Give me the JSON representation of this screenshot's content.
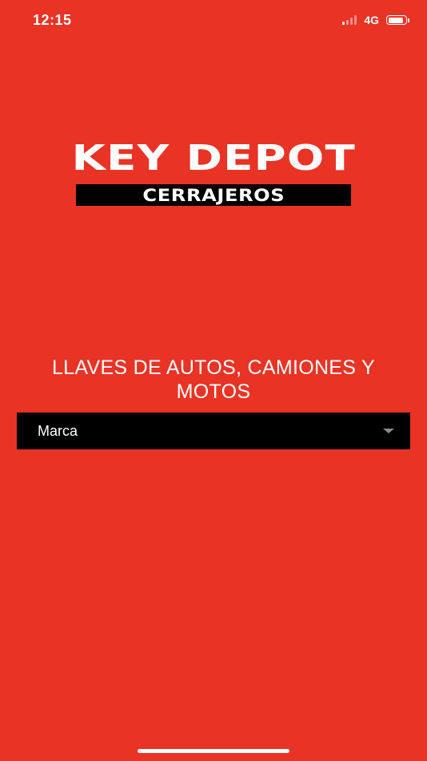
{
  "status_bar": {
    "time": "12:15",
    "network": "4G",
    "signal_bars_active": 1,
    "signal_bars_total": 4,
    "battery_level": 0.9
  },
  "logo": {
    "main": "KEY DEPOT",
    "sub": "CERRAJEROS"
  },
  "headline": "LLAVES DE AUTOS, CAMIONES Y MOTOS",
  "brand_select": {
    "selected": "Marca",
    "icon": "chevron-down-icon"
  },
  "colors": {
    "background": "#E93325",
    "select_background": "#000000",
    "text": "#FFFFFF"
  }
}
